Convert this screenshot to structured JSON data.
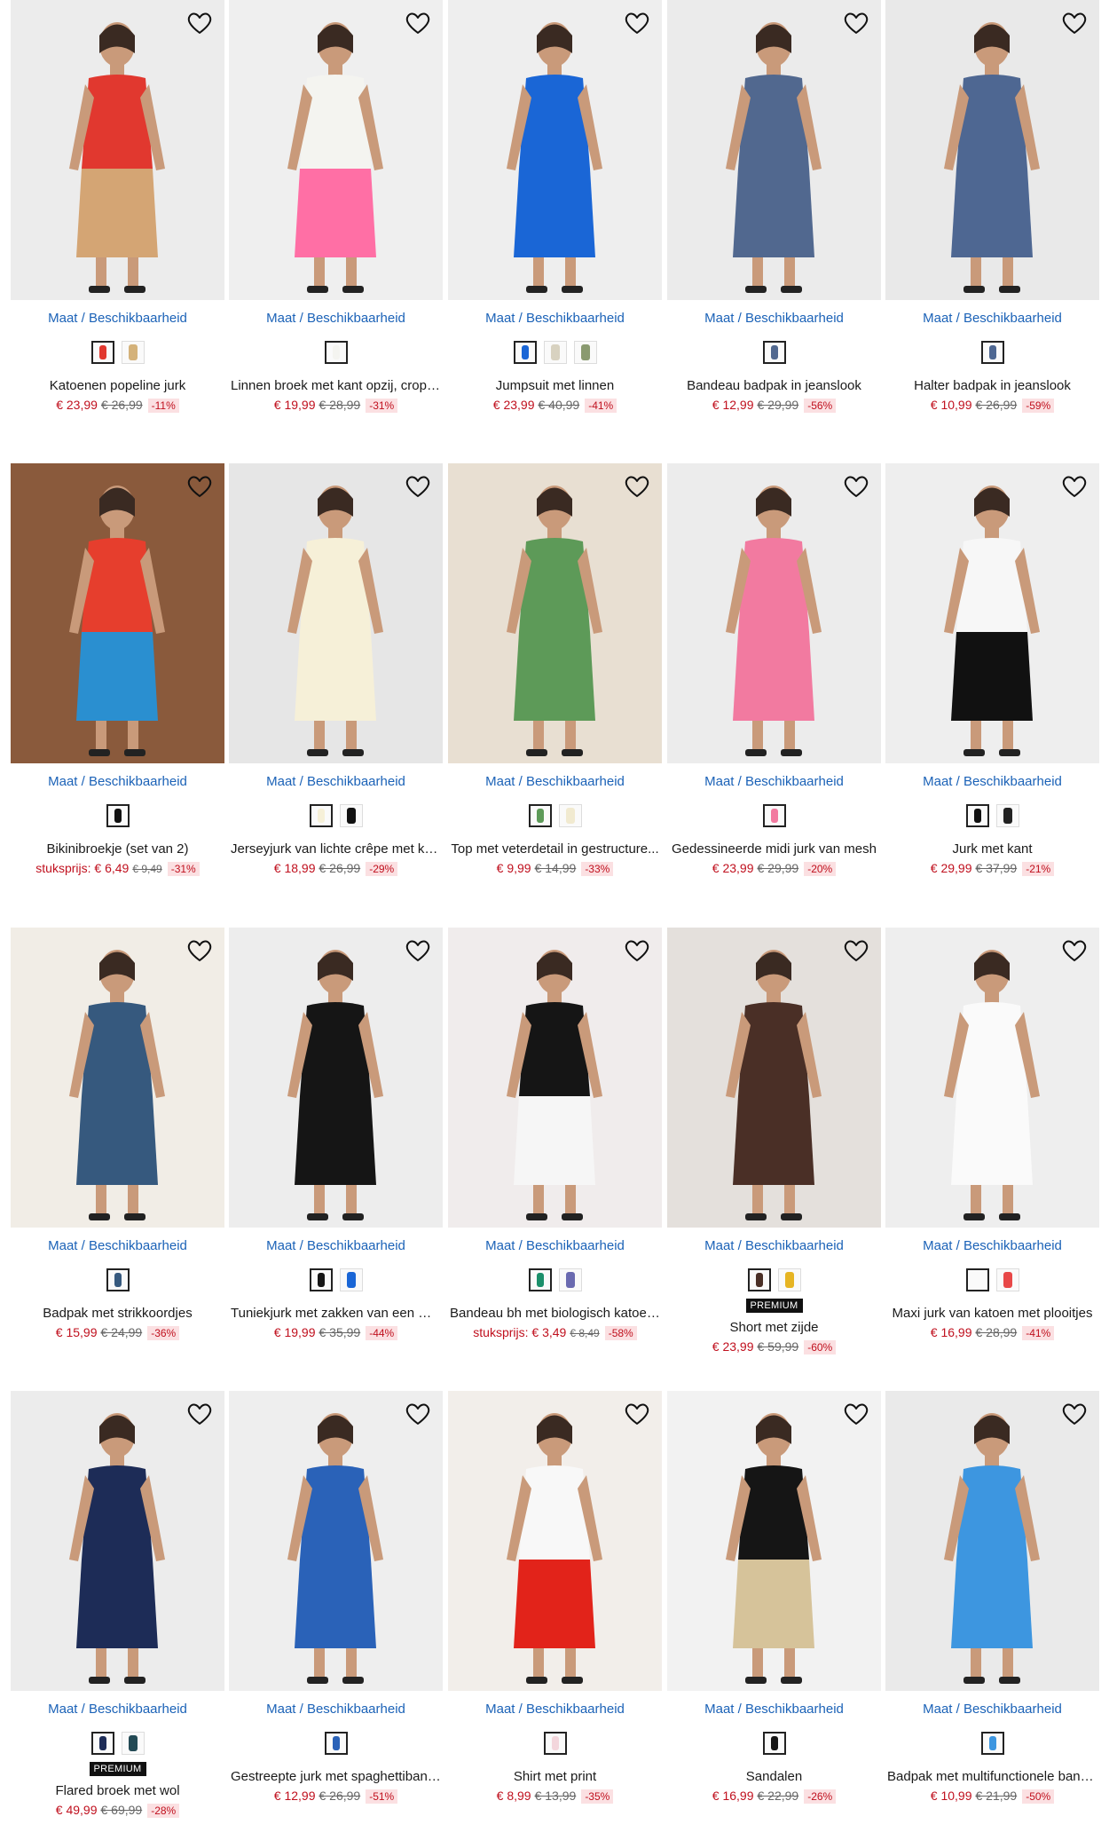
{
  "size_link_label": "Maat / Beschikbaarheid",
  "premium_label": "PREMIUM",
  "unit_price_prefix": "stuksprijs:",
  "products": [
    {
      "name": "Katoenen popeline jurk",
      "price": "€ 23,99",
      "was": "€ 26,99",
      "discount": "-11%",
      "bg": "#ececec",
      "garment": "#e1382f",
      "garment2": "#d4a574",
      "swatches": [
        "#e1382f",
        "#d4b27a"
      ]
    },
    {
      "name": "Linnen broek met kant opzij, cropped",
      "price": "€ 19,99",
      "was": "€ 28,99",
      "discount": "-31%",
      "bg": "#efefef",
      "garment": "#f4f4f0",
      "garment2": "#ff6fa5",
      "swatches": [
        "#f4f4f0"
      ]
    },
    {
      "name": "Jumpsuit met linnen",
      "price": "€ 23,99",
      "was": "€ 40,99",
      "discount": "-41%",
      "bg": "#eeeeee",
      "garment": "#1a66d6",
      "garment2": "#1a66d6",
      "swatches": [
        "#1a66d6",
        "#d8d2c0",
        "#8a9a70"
      ]
    },
    {
      "name": "Bandeau badpak in jeanslook",
      "price": "€ 12,99",
      "was": "€ 29,99",
      "discount": "-56%",
      "bg": "#ebebeb",
      "garment": "#51688f",
      "garment2": "#51688f",
      "swatches": [
        "#51688f"
      ]
    },
    {
      "name": "Halter badpak in jeanslook",
      "price": "€ 10,99",
      "was": "€ 26,99",
      "discount": "-59%",
      "bg": "#e9e9e9",
      "garment": "#4e6792",
      "garment2": "#4e6792",
      "swatches": [
        "#4e6792"
      ]
    },
    {
      "name": "Bikinibroekje (set van 2)",
      "unit": true,
      "price": "€ 6,49",
      "was": "€ 9,49",
      "discount": "-31%",
      "bg": "#8a5a3c",
      "garment": "#e63e2d",
      "garment2": "#2a8fd0",
      "swatches": [
        "#111111"
      ]
    },
    {
      "name": "Jerseyjurk van lichte crêpe met ka...",
      "price": "€ 18,99",
      "was": "€ 26,99",
      "discount": "-29%",
      "bg": "#e6e6e6",
      "garment": "#f6f0d8",
      "garment2": "#f6f0d8",
      "swatches": [
        "#f6f0d8",
        "#111111"
      ]
    },
    {
      "name": "Top met veterdetail in gestructure...",
      "price": "€ 9,99",
      "was": "€ 14,99",
      "discount": "-33%",
      "bg": "#e8dfd2",
      "garment": "#5d9a58",
      "garment2": "#5d9a58",
      "swatches": [
        "#5d9a58",
        "#f1ead0"
      ]
    },
    {
      "name": "Gedessineerde midi jurk van mesh",
      "price": "€ 23,99",
      "was": "€ 29,99",
      "discount": "-20%",
      "bg": "#ececec",
      "garment": "#f27aa0",
      "garment2": "#f27aa0",
      "swatches": [
        "#f27aa0"
      ]
    },
    {
      "name": "Jurk met kant",
      "price": "€ 29,99",
      "was": "€ 37,99",
      "discount": "-21%",
      "bg": "#eeeeee",
      "garment": "#f7f7f7",
      "garment2": "#111111",
      "swatches": [
        "#111111",
        "#222222"
      ]
    },
    {
      "name": "Badpak met strikkoordjes",
      "price": "€ 15,99",
      "was": "€ 24,99",
      "discount": "-36%",
      "bg": "#f1ede6",
      "garment": "#36597e",
      "garment2": "#36597e",
      "swatches": [
        "#36597e"
      ]
    },
    {
      "name": "Tuniekjurk met zakken van een mix...",
      "price": "€ 19,99",
      "was": "€ 35,99",
      "discount": "-44%",
      "bg": "#ededed",
      "garment": "#151515",
      "garment2": "#151515",
      "swatches": [
        "#151515",
        "#1a66d6"
      ]
    },
    {
      "name": "Bandeau bh met biologisch katoen (...",
      "unit": true,
      "price": "€ 3,49",
      "was": "€ 8,49",
      "discount": "-58%",
      "bg": "#f0ecec",
      "garment": "#151515",
      "garment2": "#f6f6f6",
      "swatches": [
        "#1a8f6a",
        "#6a6ab0"
      ]
    },
    {
      "name": "Short met zijde",
      "premium": true,
      "price": "€ 23,99",
      "was": "€ 59,99",
      "discount": "-60%",
      "bg": "#e4e0dc",
      "garment": "#4a2f26",
      "garment2": "#4a2f26",
      "swatches": [
        "#4a2f26",
        "#e6b422"
      ]
    },
    {
      "name": "Maxi jurk van katoen met plooitjes",
      "price": "€ 16,99",
      "was": "€ 28,99",
      "discount": "-41%",
      "bg": "#eeeeee",
      "garment": "#fafafa",
      "garment2": "#fafafa",
      "swatches": [
        "#fafafa",
        "#e84848"
      ]
    },
    {
      "name": "Flared broek met wol",
      "premium": true,
      "price": "€ 49,99",
      "was": "€ 69,99",
      "discount": "-28%",
      "bg": "#ececec",
      "garment": "#1d2c57",
      "garment2": "#1d2c57",
      "swatches": [
        "#1d2c57",
        "#234a55"
      ]
    },
    {
      "name": "Gestreepte jurk met spaghettiband...",
      "price": "€ 12,99",
      "was": "€ 26,99",
      "discount": "-51%",
      "bg": "#eeeeee",
      "garment": "#2a62b8",
      "garment2": "#2a62b8",
      "swatches": [
        "#2a62b8"
      ]
    },
    {
      "name": "Shirt met print",
      "price": "€ 8,99",
      "was": "€ 13,99",
      "discount": "-35%",
      "bg": "#f2eeea",
      "garment": "#f8f8f8",
      "garment2": "#e2231a",
      "swatches": [
        "#f3d6dc"
      ]
    },
    {
      "name": "Sandalen",
      "price": "€ 16,99",
      "was": "€ 22,99",
      "discount": "-26%",
      "bg": "#f2f2f2",
      "garment": "#151515",
      "garment2": "#d6c39a",
      "swatches": [
        "#151515"
      ]
    },
    {
      "name": "Badpak met multifunctionele bandjes",
      "price": "€ 10,99",
      "was": "€ 21,99",
      "discount": "-50%",
      "bg": "#eaeaea",
      "garment": "#3d96e0",
      "garment2": "#3d96e0",
      "swatches": [
        "#3d96e0"
      ]
    }
  ]
}
